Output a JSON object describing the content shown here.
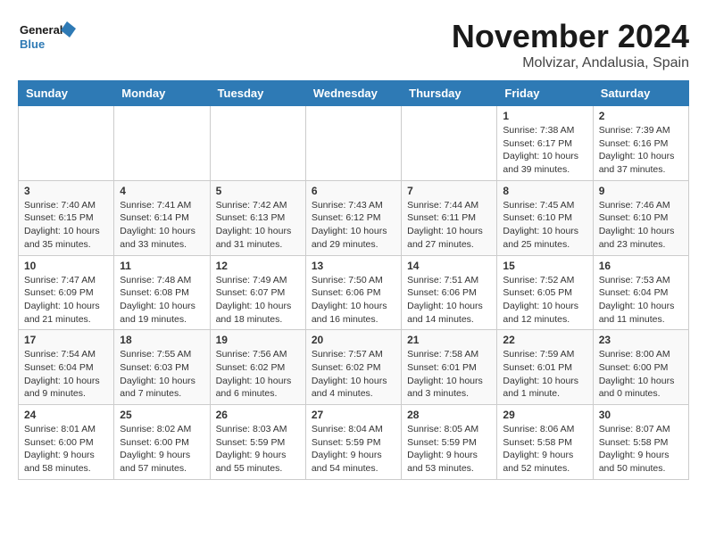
{
  "header": {
    "logo_line1": "General",
    "logo_line2": "Blue",
    "month_title": "November 2024",
    "location": "Molvizar, Andalusia, Spain"
  },
  "weekdays": [
    "Sunday",
    "Monday",
    "Tuesday",
    "Wednesday",
    "Thursday",
    "Friday",
    "Saturday"
  ],
  "weeks": [
    [
      {
        "day": "",
        "info": ""
      },
      {
        "day": "",
        "info": ""
      },
      {
        "day": "",
        "info": ""
      },
      {
        "day": "",
        "info": ""
      },
      {
        "day": "",
        "info": ""
      },
      {
        "day": "1",
        "info": "Sunrise: 7:38 AM\nSunset: 6:17 PM\nDaylight: 10 hours and 39 minutes."
      },
      {
        "day": "2",
        "info": "Sunrise: 7:39 AM\nSunset: 6:16 PM\nDaylight: 10 hours and 37 minutes."
      }
    ],
    [
      {
        "day": "3",
        "info": "Sunrise: 7:40 AM\nSunset: 6:15 PM\nDaylight: 10 hours and 35 minutes."
      },
      {
        "day": "4",
        "info": "Sunrise: 7:41 AM\nSunset: 6:14 PM\nDaylight: 10 hours and 33 minutes."
      },
      {
        "day": "5",
        "info": "Sunrise: 7:42 AM\nSunset: 6:13 PM\nDaylight: 10 hours and 31 minutes."
      },
      {
        "day": "6",
        "info": "Sunrise: 7:43 AM\nSunset: 6:12 PM\nDaylight: 10 hours and 29 minutes."
      },
      {
        "day": "7",
        "info": "Sunrise: 7:44 AM\nSunset: 6:11 PM\nDaylight: 10 hours and 27 minutes."
      },
      {
        "day": "8",
        "info": "Sunrise: 7:45 AM\nSunset: 6:10 PM\nDaylight: 10 hours and 25 minutes."
      },
      {
        "day": "9",
        "info": "Sunrise: 7:46 AM\nSunset: 6:10 PM\nDaylight: 10 hours and 23 minutes."
      }
    ],
    [
      {
        "day": "10",
        "info": "Sunrise: 7:47 AM\nSunset: 6:09 PM\nDaylight: 10 hours and 21 minutes."
      },
      {
        "day": "11",
        "info": "Sunrise: 7:48 AM\nSunset: 6:08 PM\nDaylight: 10 hours and 19 minutes."
      },
      {
        "day": "12",
        "info": "Sunrise: 7:49 AM\nSunset: 6:07 PM\nDaylight: 10 hours and 18 minutes."
      },
      {
        "day": "13",
        "info": "Sunrise: 7:50 AM\nSunset: 6:06 PM\nDaylight: 10 hours and 16 minutes."
      },
      {
        "day": "14",
        "info": "Sunrise: 7:51 AM\nSunset: 6:06 PM\nDaylight: 10 hours and 14 minutes."
      },
      {
        "day": "15",
        "info": "Sunrise: 7:52 AM\nSunset: 6:05 PM\nDaylight: 10 hours and 12 minutes."
      },
      {
        "day": "16",
        "info": "Sunrise: 7:53 AM\nSunset: 6:04 PM\nDaylight: 10 hours and 11 minutes."
      }
    ],
    [
      {
        "day": "17",
        "info": "Sunrise: 7:54 AM\nSunset: 6:04 PM\nDaylight: 10 hours and 9 minutes."
      },
      {
        "day": "18",
        "info": "Sunrise: 7:55 AM\nSunset: 6:03 PM\nDaylight: 10 hours and 7 minutes."
      },
      {
        "day": "19",
        "info": "Sunrise: 7:56 AM\nSunset: 6:02 PM\nDaylight: 10 hours and 6 minutes."
      },
      {
        "day": "20",
        "info": "Sunrise: 7:57 AM\nSunset: 6:02 PM\nDaylight: 10 hours and 4 minutes."
      },
      {
        "day": "21",
        "info": "Sunrise: 7:58 AM\nSunset: 6:01 PM\nDaylight: 10 hours and 3 minutes."
      },
      {
        "day": "22",
        "info": "Sunrise: 7:59 AM\nSunset: 6:01 PM\nDaylight: 10 hours and 1 minute."
      },
      {
        "day": "23",
        "info": "Sunrise: 8:00 AM\nSunset: 6:00 PM\nDaylight: 10 hours and 0 minutes."
      }
    ],
    [
      {
        "day": "24",
        "info": "Sunrise: 8:01 AM\nSunset: 6:00 PM\nDaylight: 9 hours and 58 minutes."
      },
      {
        "day": "25",
        "info": "Sunrise: 8:02 AM\nSunset: 6:00 PM\nDaylight: 9 hours and 57 minutes."
      },
      {
        "day": "26",
        "info": "Sunrise: 8:03 AM\nSunset: 5:59 PM\nDaylight: 9 hours and 55 minutes."
      },
      {
        "day": "27",
        "info": "Sunrise: 8:04 AM\nSunset: 5:59 PM\nDaylight: 9 hours and 54 minutes."
      },
      {
        "day": "28",
        "info": "Sunrise: 8:05 AM\nSunset: 5:59 PM\nDaylight: 9 hours and 53 minutes."
      },
      {
        "day": "29",
        "info": "Sunrise: 8:06 AM\nSunset: 5:58 PM\nDaylight: 9 hours and 52 minutes."
      },
      {
        "day": "30",
        "info": "Sunrise: 8:07 AM\nSunset: 5:58 PM\nDaylight: 9 hours and 50 minutes."
      }
    ]
  ]
}
